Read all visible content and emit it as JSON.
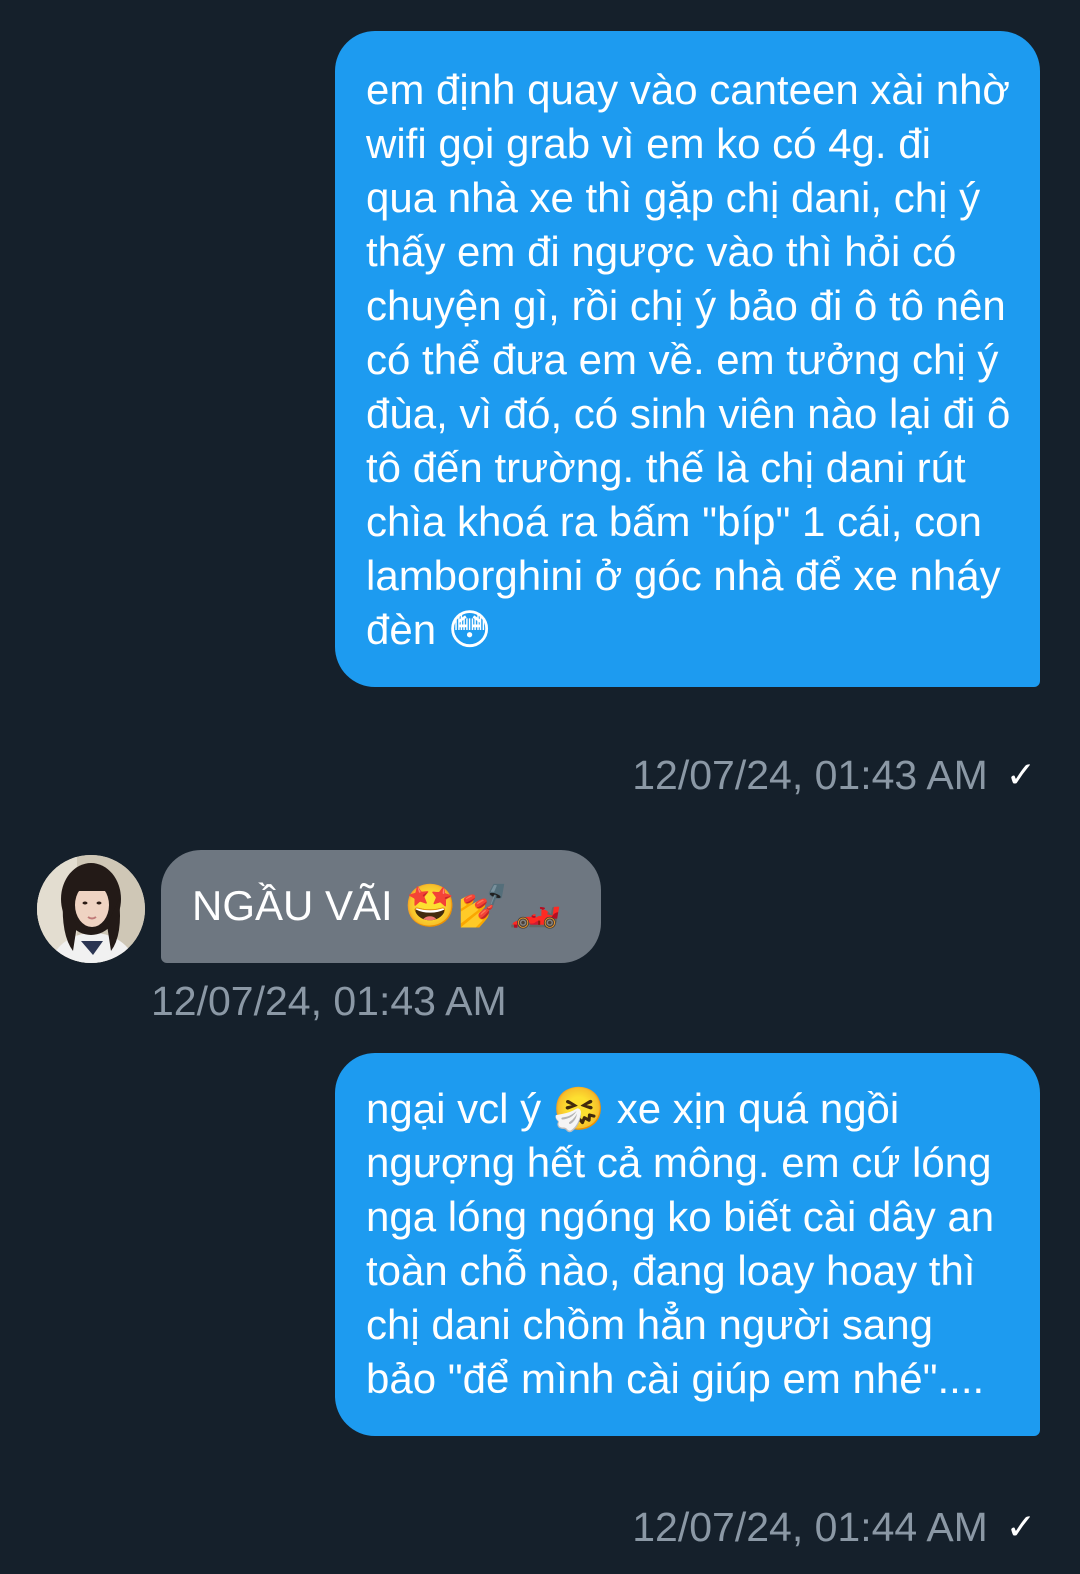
{
  "messages": [
    {
      "direction": "sent",
      "text": "em định quay vào canteen xài nhờ wifi gọi grab vì em ko có 4g. đi qua nhà xe thì gặp chị dani, chị ý thấy em đi ngược vào thì hỏi có chuyện gì, rồi chị ý bảo đi ô tô nên có thể đưa em về. em tưởng chị ý đùa, vì đó, có sinh viên nào lại đi ô tô đến trường. thế là chị dani rút chìa khoá ra bấm \"bíp\" 1 cái, con lamborghini ở góc nhà để xe nháy đèn 😳",
      "timestamp": "12/07/24, 01:43 AM",
      "status_icon": "check-icon",
      "status_glyph": "✓"
    },
    {
      "direction": "received",
      "text": "NGẦU VÃI 🤩💅🏎️",
      "timestamp": "12/07/24, 01:43 AM",
      "avatar": "contact-avatar"
    },
    {
      "direction": "sent",
      "text": "ngại vcl ý 🤧 xe xịn quá ngồi ngượng hết cả mông. em cứ lóng nga lóng ngóng ko biết cài dây an toàn chỗ nào, đang loay hoay thì chị dani chồm hẳn người sang bảo \"để mình cài giúp em nhé\"....",
      "timestamp": "12/07/24, 01:44 AM",
      "status_icon": "check-icon",
      "status_glyph": "✓"
    }
  ],
  "colors": {
    "background": "#15202b",
    "sent_bubble": "#1d9bf0",
    "received_bubble": "#6e7781",
    "timestamp_text": "#8b98a5",
    "message_text": "#ffffff"
  }
}
